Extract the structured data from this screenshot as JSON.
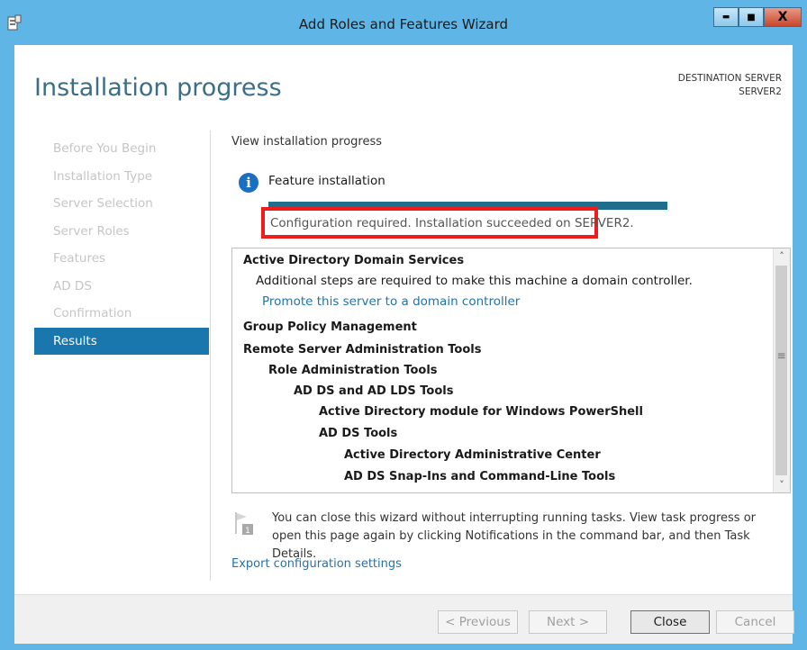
{
  "window": {
    "title": "Add Roles and Features Wizard",
    "controls": {
      "minimize": "▬",
      "maximize": "■",
      "close": "X"
    }
  },
  "page": {
    "heading": "Installation progress",
    "destination_label": "DESTINATION SERVER",
    "destination_server": "SERVER2"
  },
  "nav": {
    "items": [
      {
        "label": "Before You Begin",
        "active": false
      },
      {
        "label": "Installation Type",
        "active": false
      },
      {
        "label": "Server Selection",
        "active": false
      },
      {
        "label": "Server Roles",
        "active": false
      },
      {
        "label": "Features",
        "active": false
      },
      {
        "label": "AD DS",
        "active": false
      },
      {
        "label": "Confirmation",
        "active": false
      },
      {
        "label": "Results",
        "active": true
      }
    ]
  },
  "main": {
    "view_progress": "View installation progress",
    "feature_label": "Feature installation",
    "progress_fraction": 1.0,
    "status": "Configuration required. Installation succeeded on SERVER2.",
    "results": [
      {
        "text": "Active Directory Domain Services",
        "type": "bold",
        "level": 0
      },
      {
        "text": "Additional steps are required to make this machine a domain controller.",
        "type": "normal",
        "level": 0.5
      },
      {
        "text": "Promote this server to a domain controller",
        "type": "link",
        "level": 0.75
      },
      {
        "text": "Group Policy Management",
        "type": "bold",
        "level": 0
      },
      {
        "text": "Remote Server Administration Tools",
        "type": "bold",
        "level": 0
      },
      {
        "text": "Role Administration Tools",
        "type": "bold",
        "level": 1
      },
      {
        "text": "AD DS and AD LDS Tools",
        "type": "bold",
        "level": 2
      },
      {
        "text": "Active Directory module for Windows PowerShell",
        "type": "bold",
        "level": 3
      },
      {
        "text": "AD DS Tools",
        "type": "bold",
        "level": 3
      },
      {
        "text": "Active Directory Administrative Center",
        "type": "bold",
        "level": 4
      },
      {
        "text": "AD DS Snap-Ins and Command-Line Tools",
        "type": "bold",
        "level": 4
      }
    ],
    "note": "You can close this wizard without interrupting running tasks. View task progress or open this page again by clicking Notifications in the command bar, and then Task Details.",
    "export_link": "Export configuration settings"
  },
  "footer": {
    "previous": "< Previous",
    "next": "Next >",
    "close": "Close",
    "cancel": "Cancel"
  },
  "colors": {
    "frame": "#5fb6e6",
    "active_nav": "#1a77ae",
    "heading": "#3c6f86",
    "link": "#2472a8",
    "progress": "#1f6e8c",
    "highlight_box": "#ee1c1c"
  }
}
